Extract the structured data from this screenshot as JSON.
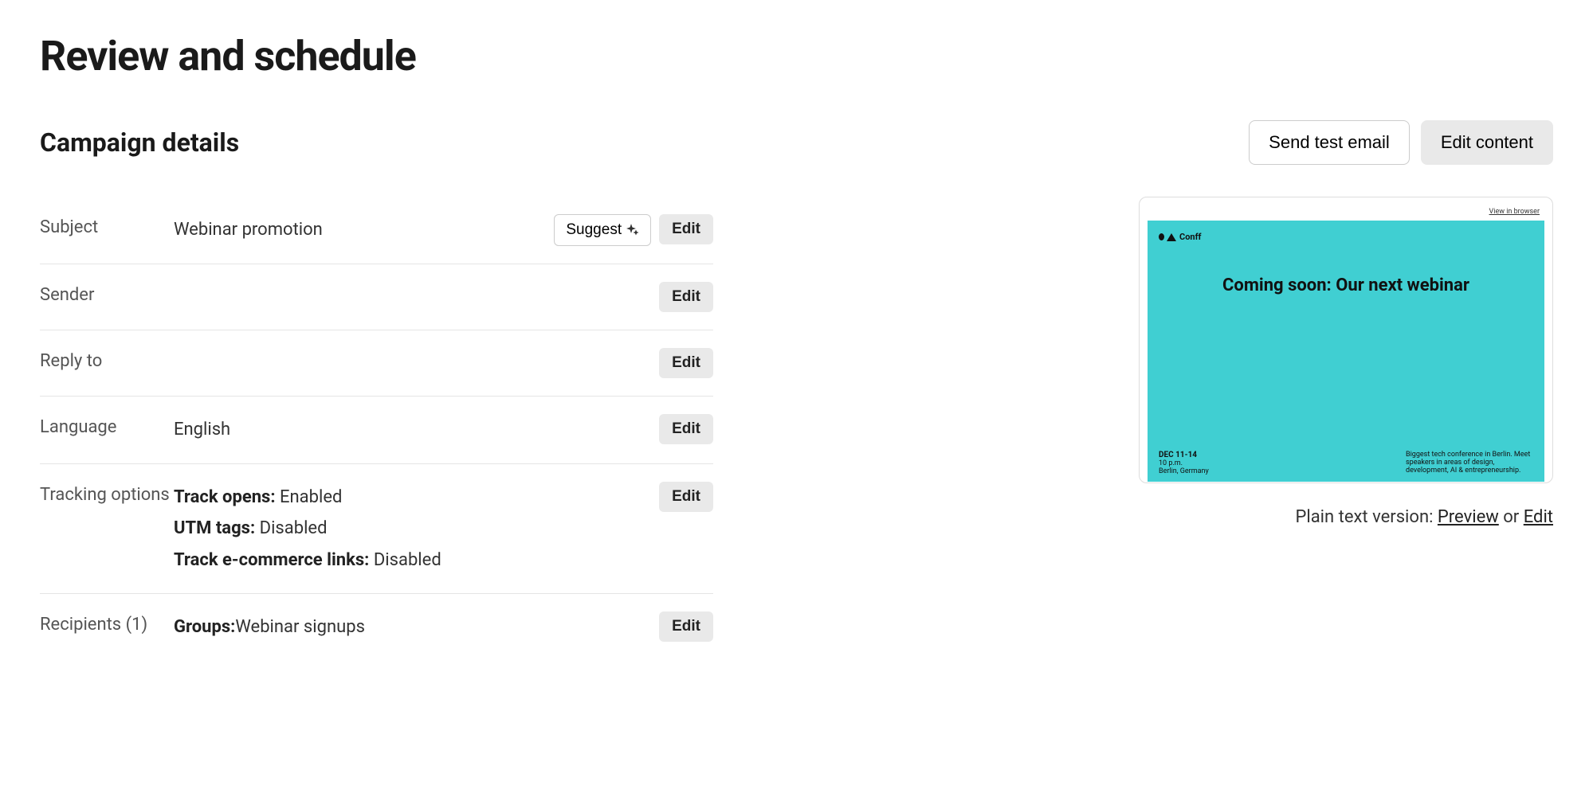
{
  "page_title": "Review and schedule",
  "section_title": "Campaign details",
  "buttons": {
    "send_test": "Send test email",
    "edit_content": "Edit content",
    "suggest": "Suggest",
    "edit": "Edit"
  },
  "details": {
    "subject": {
      "label": "Subject",
      "value": "Webinar promotion"
    },
    "sender": {
      "label": "Sender",
      "value": ""
    },
    "reply_to": {
      "label": "Reply to",
      "value": ""
    },
    "language": {
      "label": "Language",
      "value": "English"
    },
    "tracking": {
      "label": "Tracking options",
      "track_opens_label": "Track opens:",
      "track_opens_value": "Enabled",
      "utm_label": "UTM tags:",
      "utm_value": "Disabled",
      "ecom_label": "Track e-commerce links:",
      "ecom_value": "Disabled"
    },
    "recipients": {
      "label": "Recipients (1)",
      "groups_label": "Groups:",
      "groups_value": "Webinar signups"
    }
  },
  "preview": {
    "view_link": "View in browser",
    "brand": "Conff",
    "headline": "Coming soon: Our next webinar",
    "date": "DEC 11-14",
    "time": "10 p.m.",
    "location": "Berlin, Germany",
    "blurb": "Biggest tech conference in Berlin. Meet speakers in areas of design, development, AI & entrepreneurship."
  },
  "plain_text": {
    "label": "Plain text version:",
    "preview": "Preview",
    "or": "or",
    "edit": "Edit"
  }
}
